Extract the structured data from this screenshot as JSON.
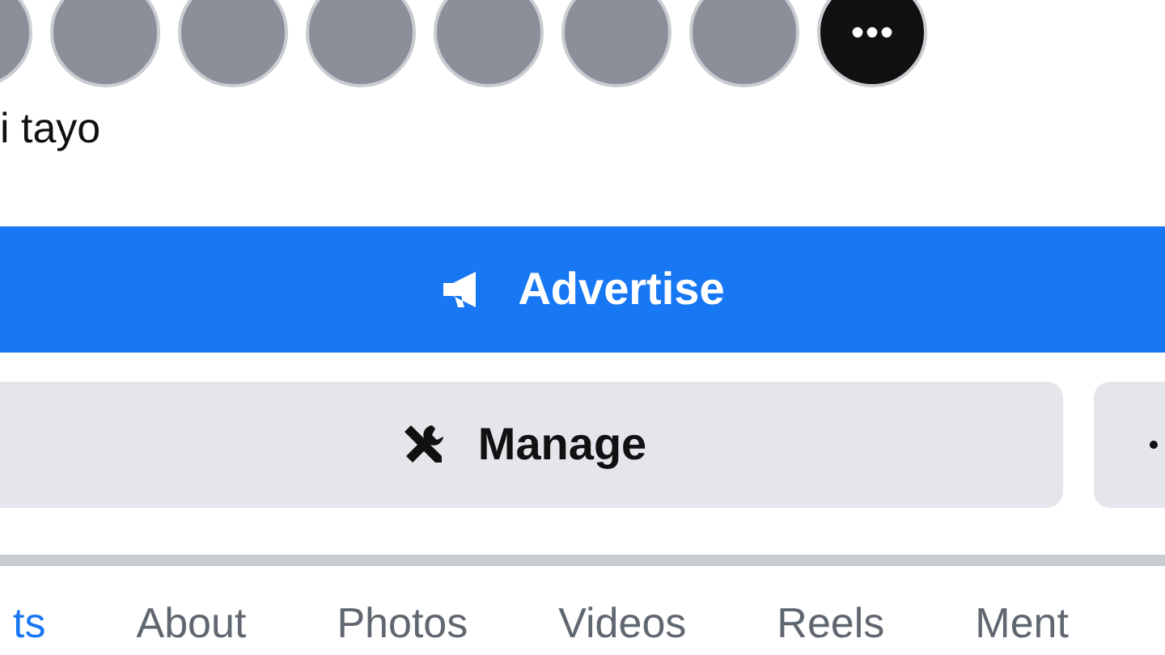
{
  "avatars": [
    {
      "kind": "photo"
    },
    {
      "kind": "photo"
    },
    {
      "kind": "photo"
    },
    {
      "kind": "photo"
    },
    {
      "kind": "photo"
    },
    {
      "kind": "photo"
    },
    {
      "kind": "photo"
    },
    {
      "kind": "more"
    }
  ],
  "caption": "i tayo",
  "primary_button": {
    "label": "Advertise"
  },
  "secondary_buttons": [
    {
      "kind": "manage",
      "label": "Manage"
    },
    {
      "kind": "more"
    }
  ],
  "tabs": [
    {
      "label": "ts",
      "selected": true
    },
    {
      "label": "About",
      "selected": false
    },
    {
      "label": "Photos",
      "selected": false
    },
    {
      "label": "Videos",
      "selected": false
    },
    {
      "label": "Reels",
      "selected": false
    },
    {
      "label": "Ment",
      "selected": false
    }
  ]
}
